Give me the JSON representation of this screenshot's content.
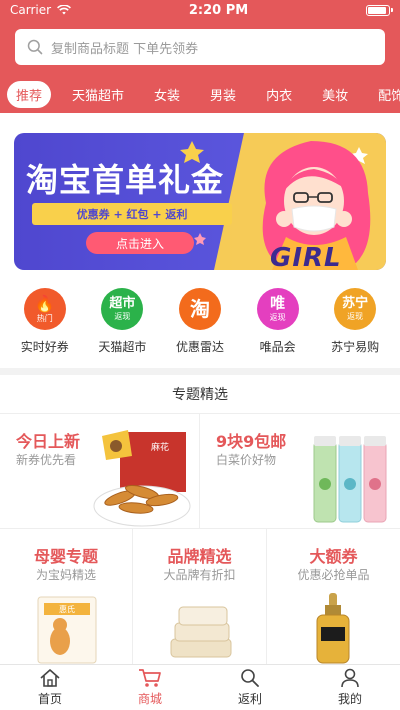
{
  "status_bar": {
    "carrier": "Carrier",
    "time": "2:20 PM"
  },
  "search": {
    "placeholder": "复制商品标题 下单先领券"
  },
  "tabs": [
    {
      "label": "推荐",
      "active": true
    },
    {
      "label": "天猫超市"
    },
    {
      "label": "女装"
    },
    {
      "label": "男装"
    },
    {
      "label": "内衣"
    },
    {
      "label": "美妆"
    },
    {
      "label": "配饰"
    }
  ],
  "banner": {
    "title": "淘宝首单礼金",
    "ribbon": "优惠券 + 红包 + 返利",
    "button": "点击进入",
    "image_text": "GIRL"
  },
  "categories": [
    {
      "icon": "fire-icon",
      "glyph": "🔥",
      "badge": "热门",
      "label": "实时好券",
      "color": "#f15a2b"
    },
    {
      "icon": "tmall-icon",
      "glyph": "超市",
      "badge": "返现",
      "label": "天猫超市",
      "color": "#2bb24a"
    },
    {
      "icon": "taobao-icon",
      "glyph": "淘",
      "badge": "",
      "label": "优惠雷达",
      "color": "#f36b1c"
    },
    {
      "icon": "vip-icon",
      "glyph": "唯",
      "badge": "返现",
      "label": "唯品会",
      "color": "#e43fbf"
    },
    {
      "icon": "suning-icon",
      "glyph": "苏宁",
      "badge": "返现",
      "label": "苏宁易购",
      "color": "#f0a325"
    }
  ],
  "featured": {
    "title": "专题精选",
    "cards_top": [
      {
        "title": "今日上新",
        "subtitle": "新券优先看",
        "color": "#e4585a"
      },
      {
        "title": "9块9包邮",
        "subtitle": "白菜价好物",
        "color": "#e4585a"
      }
    ],
    "cards_bottom": [
      {
        "title": "母婴专题",
        "subtitle": "为宝妈精选",
        "color": "#e4585a"
      },
      {
        "title": "品牌精选",
        "subtitle": "大品牌有折扣",
        "color": "#e4585a"
      },
      {
        "title": "大额券",
        "subtitle": "优惠必抢单品",
        "color": "#e4585a"
      }
    ],
    "product_labels": {
      "snack_box": "麻花",
      "milk_brand": "惠氏"
    }
  },
  "bottom_nav": [
    {
      "icon": "home-icon",
      "label": "首页",
      "active": false
    },
    {
      "icon": "cart-icon",
      "label": "商城",
      "active": true
    },
    {
      "icon": "search-icon",
      "label": "返利",
      "active": false
    },
    {
      "icon": "user-icon",
      "label": "我的",
      "active": false
    }
  ],
  "colors": {
    "brand": "#e4585a",
    "banner_bg": "#4f47cf",
    "banner_ribbon": "#f9d04b"
  }
}
